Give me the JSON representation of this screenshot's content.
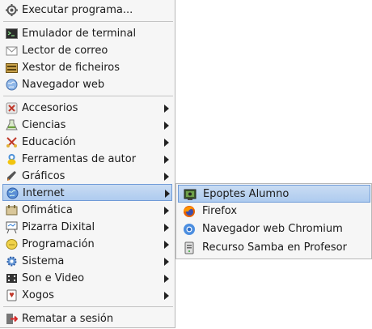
{
  "menu": {
    "run_program": "Executar programa...",
    "terminal": "Emulador de terminal",
    "mail": "Lector de correo",
    "files": "Xestor de ficheiros",
    "web": "Navegador web",
    "categories": [
      {
        "label": "Accesorios",
        "icon": "accessories-icon"
      },
      {
        "label": "Ciencias",
        "icon": "science-icon"
      },
      {
        "label": "Educación",
        "icon": "education-icon"
      },
      {
        "label": "Ferramentas de autor",
        "icon": "authoring-icon"
      },
      {
        "label": "Gráficos",
        "icon": "graphics-icon"
      },
      {
        "label": "Internet",
        "icon": "internet-icon"
      },
      {
        "label": "Ofimática",
        "icon": "office-icon"
      },
      {
        "label": "Pizarra Dixital",
        "icon": "whiteboard-icon"
      },
      {
        "label": "Programación",
        "icon": "programming-icon"
      },
      {
        "label": "Sistema",
        "icon": "system-icon"
      },
      {
        "label": "Son e Video",
        "icon": "multimedia-icon"
      },
      {
        "label": "Xogos",
        "icon": "games-icon"
      }
    ],
    "logout": "Rematar a sesión"
  },
  "submenu": {
    "parent": "Internet",
    "items": [
      {
        "label": "Epoptes Alumno",
        "icon": "epoptes-icon"
      },
      {
        "label": "Firefox",
        "icon": "firefox-icon"
      },
      {
        "label": "Navegador web Chromium",
        "icon": "chromium-icon"
      },
      {
        "label": "Recurso Samba en Profesor",
        "icon": "samba-share-icon"
      }
    ]
  },
  "colors": {
    "highlight": "#aecbef",
    "highlight_border": "#6f9bd7",
    "menu_bg": "#f6f6f6"
  }
}
